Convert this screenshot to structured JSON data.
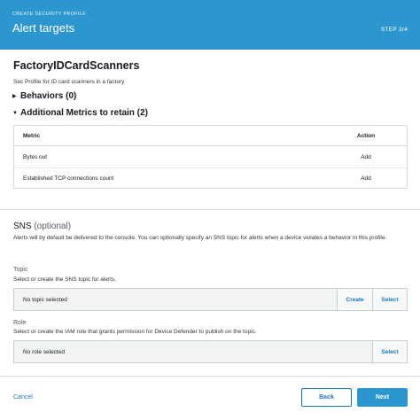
{
  "header": {
    "kicker": "CREATE SECURITY PROFILE",
    "title": "Alert targets",
    "step": "STEP 2/4"
  },
  "profile": {
    "name": "FactoryIDCardScanners",
    "description": "Sec Profile for ID card scanners in a factory"
  },
  "sections": {
    "behaviors": "Behaviors (0)",
    "metrics": "Additional Metrics to retain (2)"
  },
  "metrics_table": {
    "headers": {
      "metric": "Metric",
      "action": "Action"
    },
    "rows": [
      {
        "metric": "Bytes out",
        "action": "Add"
      },
      {
        "metric": "Established TCP connections count",
        "action": "Add"
      }
    ]
  },
  "sns": {
    "title": "SNS",
    "optional": "(optional)",
    "description": "Alerts will by default be delivered to the console. You can optionally specify an SNS topic for alerts when a device violates a behavior in this profile.",
    "topic": {
      "label": "Topic",
      "hint": "Select or create the SNS topic for alerts.",
      "value": "No topic selected",
      "create_label": "Create",
      "select_label": "Select"
    },
    "role": {
      "label": "Role",
      "hint": "Select or create the IAM role that grants permission for Device Defender to publish on the topic.",
      "value": "No role selected",
      "select_label": "Select"
    }
  },
  "footer": {
    "cancel_label": "Cancel",
    "back_label": "Back",
    "next_label": "Next"
  },
  "colors": {
    "header_bg": "#2c97cf",
    "link": "#1a76b8",
    "primary_button": "#2c97cf"
  },
  "icons": {
    "collapsed": "caret-right-icon",
    "expanded": "caret-down-icon"
  }
}
